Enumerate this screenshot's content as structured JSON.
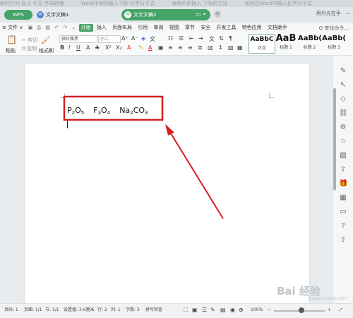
{
  "top_strip": [
    "新的行列 含义 中文 字母转换",
    "Word中如何输入下标 化学分子式",
    "表格中的插入 下标的方法",
    "如何在Word中输入化学分子式"
  ],
  "titlebar": {
    "logo": "WPS",
    "tabs": [
      {
        "label": "文字文稿1",
        "active": false
      },
      {
        "label": "文字文稿2",
        "active": true
      }
    ],
    "user": "用丹光在手"
  },
  "menubar": {
    "file": "≡ 文件 ∨",
    "items": [
      "开始",
      "插入",
      "页面布局",
      "引用",
      "审阅",
      "视图",
      "章节",
      "安全",
      "开发工具",
      "特色应用",
      "文档助手"
    ],
    "active_item": "开始",
    "search": "Q 查找命令..."
  },
  "ribbon": {
    "paste": "粘贴",
    "cut": "剪切",
    "copy": "复制",
    "format_painter": "格式刷",
    "font_name": "微软雅黑",
    "font_size": "小二",
    "styles": [
      {
        "sample": "AaBbC",
        "label": "正文",
        "selected": true
      },
      {
        "sample": "AaB",
        "label": "标题 1",
        "selected": false
      },
      {
        "sample": "AaBb(",
        "label": "标题 2",
        "selected": false
      },
      {
        "sample": "AaBb(",
        "label": "标题 3",
        "selected": false
      }
    ]
  },
  "document": {
    "formulas": [
      {
        "parts": [
          {
            "t": "P"
          },
          {
            "s": "2"
          },
          {
            "t": "O"
          },
          {
            "s": "5"
          }
        ]
      },
      {
        "parts": [
          {
            "t": "F"
          },
          {
            "s": "3"
          },
          {
            "t": "O"
          },
          {
            "s": "4"
          }
        ]
      },
      {
        "parts": [
          {
            "t": "Na"
          },
          {
            "s": "2"
          },
          {
            "t": "CO"
          },
          {
            "s": "3"
          }
        ]
      }
    ]
  },
  "statusbar": {
    "page": "页码: 1",
    "pages": "页面: 1/1",
    "section": "节: 1/1",
    "setting": "设置值: 3.6厘米",
    "row": "行: 2",
    "col": "列: 1",
    "words": "字数: 3",
    "spell": "拼写检查",
    "zoom": "100%"
  },
  "watermark": {
    "text": "Bai 经验",
    "url": "jingyan.baidu.com"
  },
  "colors": {
    "accent": "#45a468",
    "highlight_box": "#d21f1f"
  }
}
